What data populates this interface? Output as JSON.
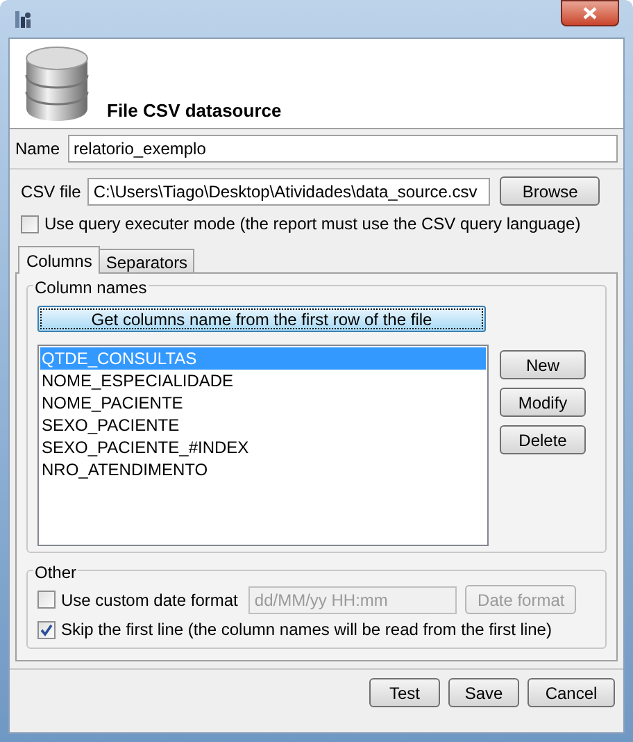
{
  "header": {
    "title": "File CSV datasource"
  },
  "name_field": {
    "label": "Name",
    "value": "relatorio_exemplo"
  },
  "csv_field": {
    "label": "CSV file",
    "value": "C:\\Users\\Tiago\\Desktop\\Atividades\\data_source.csv",
    "button": "Browse"
  },
  "query_mode": {
    "label": "Use query executer mode (the report must use the CSV query language)",
    "checked": false
  },
  "tabs": [
    {
      "label": "Columns",
      "selected": true
    },
    {
      "label": "Separators",
      "selected": false
    }
  ],
  "column_names": {
    "title": "Column names",
    "get_button": "Get columns name from the first row of the file",
    "items": [
      {
        "label": "QTDE_CONSULTAS",
        "selected": true
      },
      {
        "label": "NOME_ESPECIALIDADE",
        "selected": false
      },
      {
        "label": "NOME_PACIENTE",
        "selected": false
      },
      {
        "label": "SEXO_PACIENTE",
        "selected": false
      },
      {
        "label": "SEXO_PACIENTE_#INDEX",
        "selected": false
      },
      {
        "label": "NRO_ATENDIMENTO",
        "selected": false
      }
    ],
    "buttons": [
      "New",
      "Modify",
      "Delete"
    ]
  },
  "other": {
    "title": "Other",
    "custom_date": {
      "label": "Use custom date format",
      "checked": false
    },
    "date_field": {
      "value": "dd/MM/yy HH:mm",
      "disabled": true
    },
    "date_button": {
      "label": "Date format",
      "disabled": true
    },
    "skip_first": {
      "label": "Skip the first line (the column names will be read from the first line)",
      "checked": true
    }
  },
  "buttons": [
    "Test",
    "Save",
    "Cancel"
  ]
}
